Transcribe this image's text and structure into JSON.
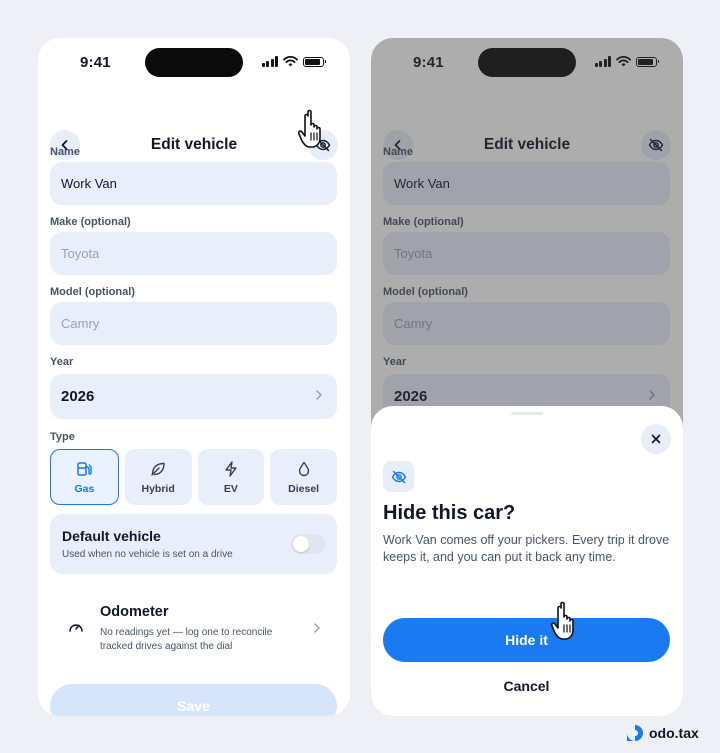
{
  "status": {
    "time": "9:41"
  },
  "left": {
    "header": {
      "title": "Edit vehicle"
    },
    "fields": {
      "name_label": "Name",
      "name_value": "Work Van",
      "make_label": "Make (optional)",
      "make_placeholder": "Toyota",
      "model_label": "Model (optional)",
      "model_placeholder": "Camry",
      "year_label": "Year",
      "year_value": "2026",
      "type_label": "Type"
    },
    "types": [
      {
        "label": "Gas",
        "icon": "fuel-pump-icon",
        "active": true
      },
      {
        "label": "Hybrid",
        "icon": "leaf-icon",
        "active": false
      },
      {
        "label": "EV",
        "icon": "lightning-icon",
        "active": false
      },
      {
        "label": "Diesel",
        "icon": "droplet-icon",
        "active": false
      }
    ],
    "default_vehicle": {
      "title": "Default vehicle",
      "subtitle": "Used when no vehicle is set on a drive",
      "enabled": false
    },
    "odometer": {
      "title": "Odometer",
      "subtitle": "No readings yet — log one to reconcile tracked drives against the dial"
    },
    "save_label": "Save"
  },
  "right": {
    "header": {
      "title": "Edit vehicle"
    },
    "fields": {
      "name_label": "Name",
      "name_value": "Work Van",
      "make_label": "Make (optional)",
      "make_placeholder": "Toyota",
      "model_label": "Model (optional)",
      "model_placeholder": "Camry",
      "year_label": "Year",
      "year_value": "2026"
    },
    "sheet": {
      "title": "Hide this car?",
      "body": "Work Van comes off your pickers. Every trip it drove keeps it, and you can put it back any time.",
      "primary_label": "Hide it",
      "cancel_label": "Cancel"
    }
  },
  "brand": {
    "name": "odo.tax"
  },
  "colors": {
    "accent": "#1a7af2",
    "field_bg": "#e9eefb",
    "text": "#101828",
    "muted": "#475467",
    "placeholder": "#98a2b3"
  }
}
